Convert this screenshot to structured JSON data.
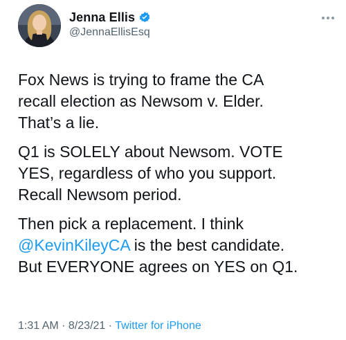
{
  "author": {
    "display_name": "Jenna Ellis",
    "handle": "@JennaEllisEsq",
    "verified": true
  },
  "tweet": {
    "paragraphs": [
      {
        "lines": [
          "Fox News is trying to frame the CA",
          "recall election as Newsom v. Elder.",
          "That’s a lie."
        ]
      },
      {
        "lines": [
          "Q1 is SOLELY about Newsom. VOTE",
          "YES, regardless of who you support.",
          "Recall Newsom period."
        ]
      },
      {
        "line1": "Then pick a replacement. I think",
        "mention": "@KevinKileyCA",
        "line2_rest": " is the best candidate.",
        "line3": "But EVERYONE agrees on YES on Q1."
      }
    ]
  },
  "meta": {
    "time": "1:31 AM",
    "separator": " · ",
    "date": "8/23/21",
    "source": "Twitter for iPhone"
  },
  "colors": {
    "text": "#0f1419",
    "secondary": "#536471",
    "link": "#1d9bf0",
    "verified_badge": "#1d9bf0"
  },
  "icons": {
    "verified": "verified-badge-icon",
    "more": "more-options-icon"
  }
}
